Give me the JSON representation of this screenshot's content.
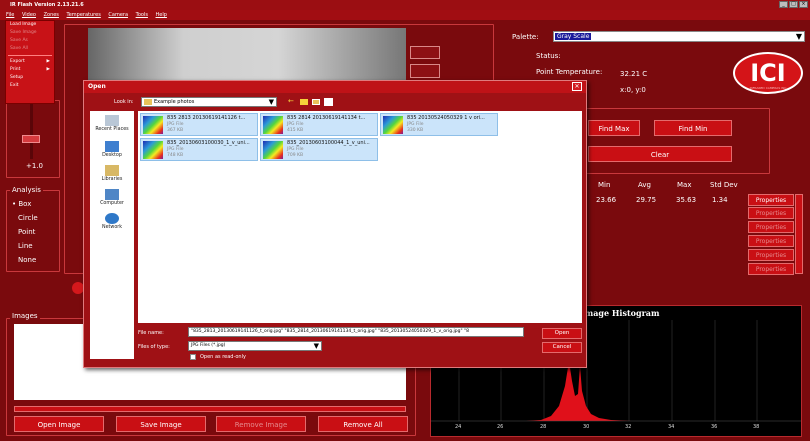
{
  "window": {
    "title": "IR Flash Version 2.13.21.6"
  },
  "menu": [
    "File",
    "Video",
    "Zones",
    "Temperatures",
    "Camera",
    "Tools",
    "Help"
  ],
  "file_menu": {
    "items": [
      {
        "label": "Load Image",
        "enabled": true
      },
      {
        "label": "Save Image",
        "enabled": false
      },
      {
        "label": "Save As",
        "enabled": false
      },
      {
        "label": "Save All",
        "enabled": false
      },
      {
        "label": "Export",
        "enabled": true,
        "submenu": true
      },
      {
        "label": "Print",
        "enabled": true,
        "submenu": true
      },
      {
        "label": "Setup",
        "enabled": true
      },
      {
        "label": "Exit",
        "enabled": true
      }
    ]
  },
  "left": {
    "value_label": "+1.0"
  },
  "analysis": {
    "title": "Analysis",
    "items": [
      "Box",
      "Circle",
      "Point",
      "Line",
      "None"
    ],
    "selected": "Box"
  },
  "right": {
    "palette_label": "Palette:",
    "palette_value": "Gray Scale",
    "status_label": "Status:",
    "point_temp_label": "Point Temperature:",
    "point_temp_value": "32.21 C",
    "coords": "x:0, y:0",
    "logo": "ICI",
    "logo_sub": "INFRARED CAMERAS INC",
    "find_max": "Find Max",
    "find_min": "Find Min",
    "clear": "Clear"
  },
  "stats": {
    "headers": [
      "Min",
      "Avg",
      "Max",
      "Std Dev"
    ],
    "values": [
      "23.66",
      "29.75",
      "35.63",
      "1.34"
    ]
  },
  "properties": [
    "Properties",
    "Properties",
    "Properties",
    "Properties",
    "Properties",
    "Properties"
  ],
  "images": {
    "title": "Images"
  },
  "bottom_buttons": {
    "open_image": "Open Image",
    "save_image": "Save Image",
    "remove_image": "Remove Image",
    "remove_all": "Remove All"
  },
  "histogram": {
    "title": "Image Histogram",
    "ticks": [
      "24",
      "26",
      "28",
      "30",
      "32",
      "34",
      "36",
      "38"
    ]
  },
  "dialog": {
    "title": "Open",
    "look_in_label": "Look in:",
    "look_in_value": "Example photos",
    "places": [
      "Recent Places",
      "Desktop",
      "Libraries",
      "Computer",
      "Network"
    ],
    "files": [
      {
        "name": "835 2813 20130619141126 t...",
        "type": "JPG File",
        "size": "367 KB"
      },
      {
        "name": "835 2814 20130619141134 t...",
        "type": "JPG File",
        "size": "415 KB"
      },
      {
        "name": "835 20130524050329 1 v ori...",
        "type": "JPG File",
        "size": "330 KB"
      },
      {
        "name": "835_20130603100030_1_v_uni...",
        "type": "JPG File",
        "size": "748 KB"
      },
      {
        "name": "835_20130603100044_1_v_uni...",
        "type": "JPG File",
        "size": "709 KB"
      }
    ],
    "file_name_label": "File name:",
    "file_name_value": "\"835_2813_20130619141126_t_orig.jpg\" \"835_2814_20130619141134_t_orig.jpg\" \"835_20130524050329_1_v_orig.jpg\" \"8",
    "file_type_label": "Files of type:",
    "file_type_value": "JPG Files (*.jpg)",
    "readonly_label": "Open as read-only",
    "open_button": "Open",
    "cancel_button": "Cancel"
  }
}
